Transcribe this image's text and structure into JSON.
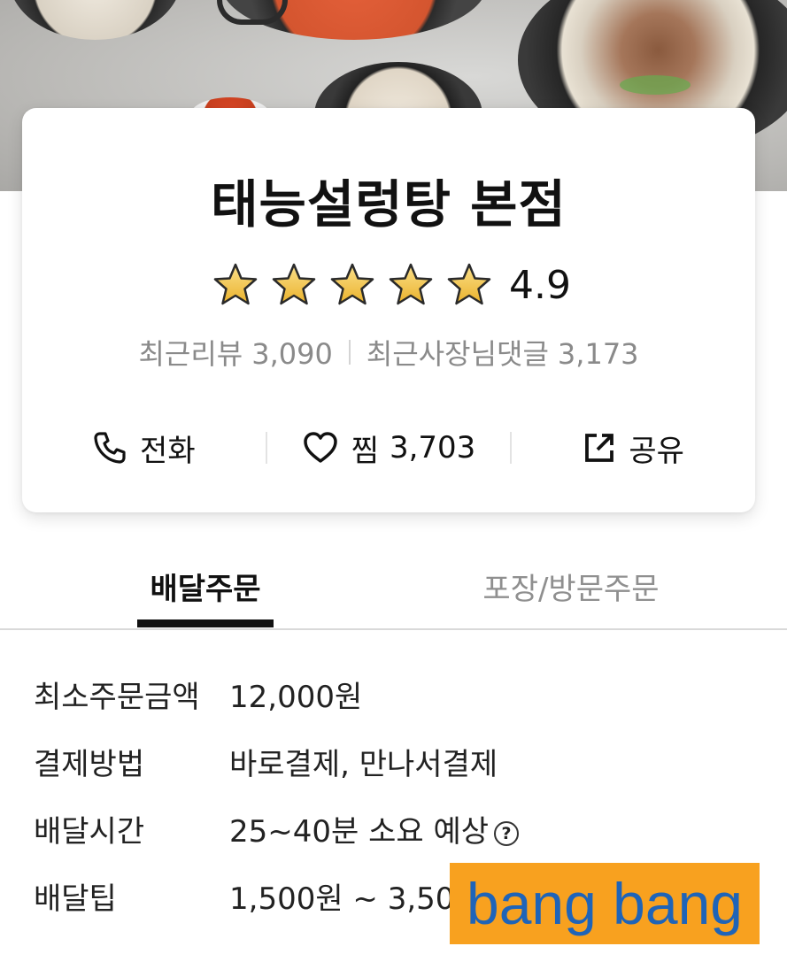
{
  "store": {
    "name": "태능설렁탕 본점",
    "rating": "4.9",
    "star_count": 5,
    "star_color": "#f3c441",
    "stats": {
      "reviews_label": "최근리뷰",
      "reviews_value": "3,090",
      "owner_replies_label": "최근사장님댓글",
      "owner_replies_value": "3,173"
    }
  },
  "actions": {
    "call": {
      "label": "전화",
      "icon": "phone-icon"
    },
    "favorite": {
      "label": "찜",
      "count": "3,703",
      "icon": "heart-icon"
    },
    "share": {
      "label": "공유",
      "icon": "share-icon"
    }
  },
  "tabs": [
    {
      "label": "배달주문",
      "active": true
    },
    {
      "label": "포장/방문주문",
      "active": false
    }
  ],
  "delivery_info": [
    {
      "label": "최소주문금액",
      "value": "12,000원"
    },
    {
      "label": "결제방법",
      "value": "바로결제, 만나서결제"
    },
    {
      "label": "배달시간",
      "value": "25~40분 소요 예상",
      "help_icon": "?"
    },
    {
      "label": "배달팁",
      "value": "1,500원 ~ 3,500원"
    }
  ],
  "watermark": {
    "text": "bang bang",
    "background": "#f8a11f",
    "color": "#1f64b8"
  }
}
